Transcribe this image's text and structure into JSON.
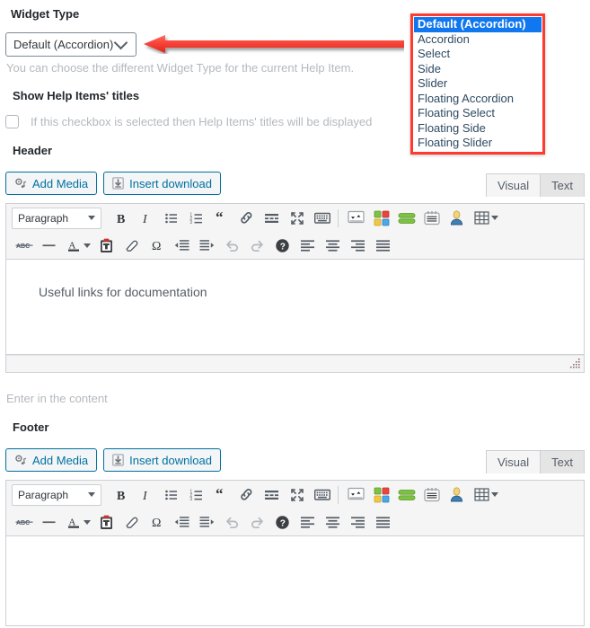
{
  "widget_type": {
    "label": "Widget Type",
    "selected_value": "Default (Accordion)",
    "help_text": "You can choose the different Widget Type for the current Help Item.",
    "options": [
      "Default (Accordion)",
      "Accordion",
      "Select",
      "Side",
      "Slider",
      "Floating Accordion",
      "Floating Select",
      "Floating Side",
      "Floating Slider"
    ],
    "highlight_color": "#ff3b30",
    "selection_color": "#1177ee"
  },
  "show_titles": {
    "label": "Show Help Items' titles",
    "checkbox_text": "If this checkbox is selected then Help Items' titles will be displayed",
    "checked": false
  },
  "header_editor": {
    "label": "Header",
    "add_media_label": "Add Media",
    "insert_download_label": "Insert download",
    "tab_visual": "Visual",
    "tab_text": "Text",
    "format_select": "Paragraph",
    "content": "Useful links for documentation",
    "below_help": "Enter in the content"
  },
  "footer_editor": {
    "label": "Footer",
    "add_media_label": "Add Media",
    "insert_download_label": "Insert download",
    "tab_visual": "Visual",
    "tab_text": "Text",
    "format_select": "Paragraph",
    "content": ""
  },
  "toolbar_row1_icons": [
    "bold-icon",
    "italic-icon",
    "bulleted-list-icon",
    "numbered-list-icon",
    "blockquote-icon",
    "link-icon",
    "horizontal-line-icon",
    "fullscreen-icon",
    "keyboard-icon",
    "sort-icon",
    "color-blocks-icon",
    "green-bar-icon",
    "lines-card-icon",
    "user-avatar-icon",
    "table-icon",
    "table-caret-icon"
  ],
  "toolbar_row2_icons": [
    "strikethrough-icon",
    "horizontal-rule-icon",
    "text-color-icon",
    "text-color-caret-icon",
    "paste-clipboard-icon",
    "clear-formatting-icon",
    "special-character-icon",
    "decrease-indent-icon",
    "increase-indent-icon",
    "undo-icon",
    "redo-icon",
    "help-icon",
    "align-left-icon",
    "align-center-icon",
    "align-right-icon",
    "align-justify-icon"
  ]
}
